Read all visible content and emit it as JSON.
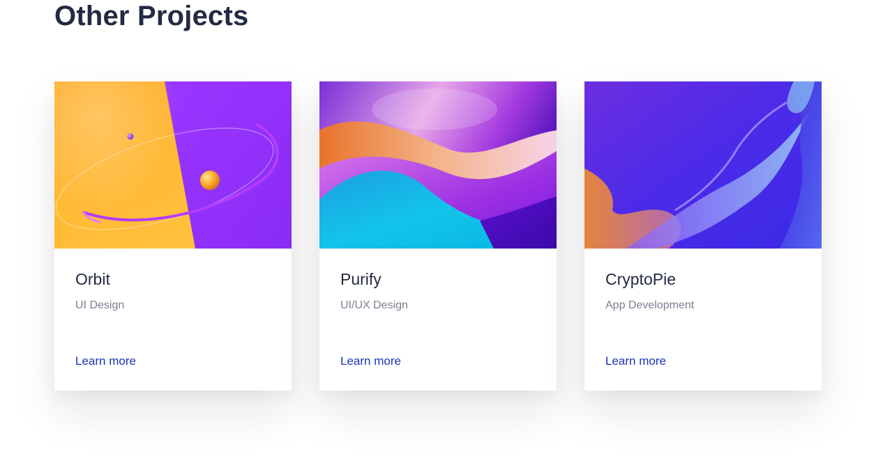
{
  "section": {
    "title": "Other Projects"
  },
  "projects": [
    {
      "title": "Orbit",
      "category": "UI Design",
      "link_label": "Learn more",
      "image_colors": [
        "#ffb22c",
        "#8e2ff7"
      ]
    },
    {
      "title": "Purify",
      "category": "UI/UX Design",
      "link_label": "Learn more",
      "image_colors": [
        "#0fb8e6",
        "#c35be0",
        "#7b1ee6"
      ]
    },
    {
      "title": "CryptoPie",
      "category": "App Development",
      "link_label": "Learn more",
      "image_colors": [
        "#4a2cf0",
        "#e0803a",
        "#7fd0f5"
      ]
    }
  ],
  "colors": {
    "heading": "#232a43",
    "muted": "#7a7f90",
    "link": "#1a34b8"
  }
}
